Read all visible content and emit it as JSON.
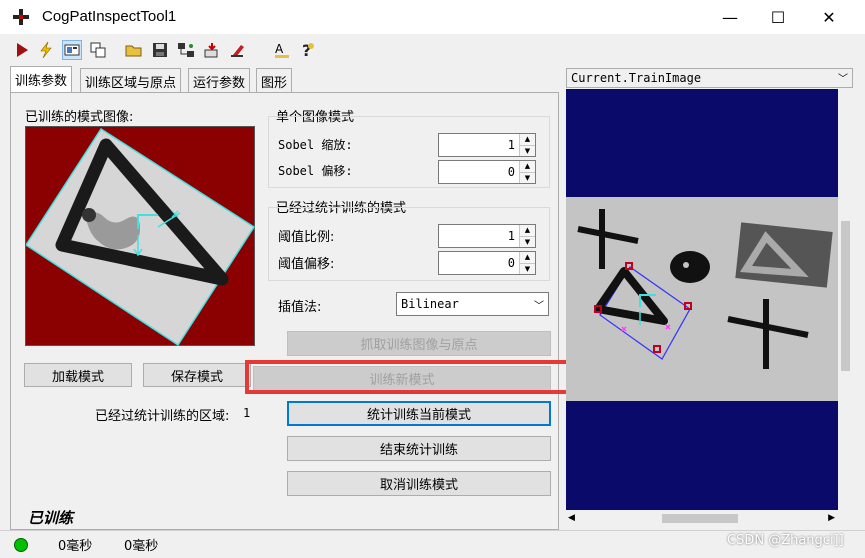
{
  "window": {
    "title": "CogPatInspectTool1",
    "minimize_glyph": "—",
    "maximize_glyph": "☐",
    "close_glyph": "✕"
  },
  "toolbar": {
    "icons": [
      "run-icon",
      "lightning-icon",
      "image-view-icon",
      "tools-icon",
      "open-folder-icon",
      "save-icon",
      "network-icon",
      "import-icon",
      "reset-icon",
      "spacer",
      "font-icon",
      "help-icon"
    ]
  },
  "tabs": [
    {
      "label": "训练参数",
      "active": true
    },
    {
      "label": "训练区域与原点",
      "active": false
    },
    {
      "label": "运行参数",
      "active": false
    },
    {
      "label": "图形",
      "active": false
    }
  ],
  "left": {
    "trained_pattern_label": "已训练的模式图像:",
    "load_button": "加载模式",
    "save_button": "保存模式",
    "stat_regions_label": "已经过统计训练的区域:",
    "stat_regions_value": "1",
    "trained_status": "已训练"
  },
  "single_image": {
    "title": "单个图像模式",
    "sobel_scale_label": "Sobel 缩放:",
    "sobel_scale_value": "1",
    "sobel_offset_label": "Sobel 偏移:",
    "sobel_offset_value": "0"
  },
  "statistical": {
    "title": "已经过统计训练的模式",
    "threshold_scale_label": "阈值比例:",
    "threshold_scale_value": "1",
    "threshold_offset_label": "阈值偏移:",
    "threshold_offset_value": "0"
  },
  "interpolation": {
    "label": "插值法:",
    "value": "Bilinear"
  },
  "actions": {
    "grab_train_image": "抓取训练图像与原点",
    "train_new_pattern": "训练新模式",
    "stat_train_current": "统计训练当前模式",
    "end_stat_training": "结束统计训练",
    "cancel_training": "取消训练模式"
  },
  "display": {
    "selected_image": "Current.TrainImage"
  },
  "status": {
    "time1": "0毫秒",
    "time2": "0毫秒",
    "indicator_color": "#00c000"
  },
  "watermark": "CSDN @Zhangci]]",
  "colors": {
    "highlight_red": "#e53935",
    "pattern_bg": "#8b0000",
    "display_bg": "#0a0a6a",
    "graphic_cyan": "#40e0e0"
  }
}
